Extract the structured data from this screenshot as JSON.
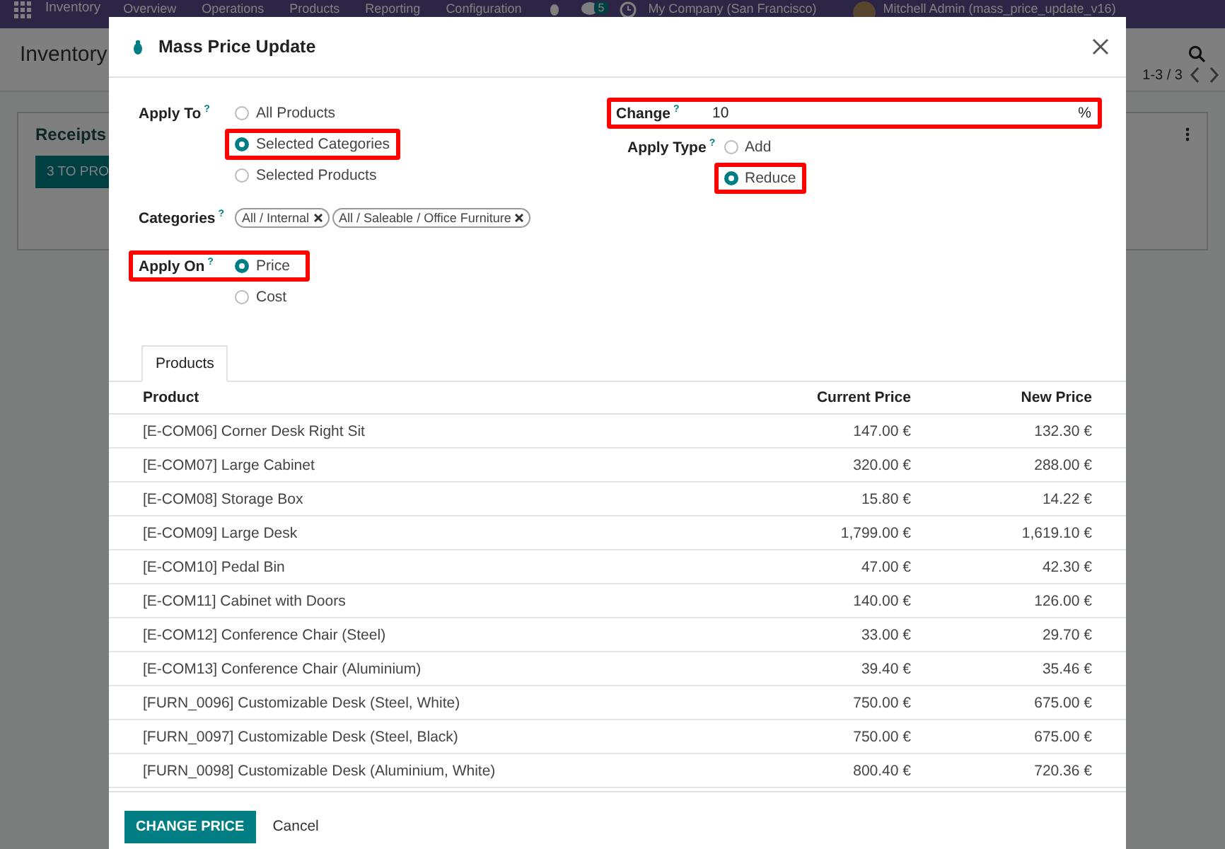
{
  "navbar": {
    "app": "Inventory",
    "menus": [
      "Overview",
      "Operations",
      "Products",
      "Reporting",
      "Configuration"
    ],
    "chat_count": "5",
    "company": "My Company (San Francisco)",
    "user": "Mitchell Admin (mass_price_update_v16)"
  },
  "background": {
    "breadcrumb": "Inventory",
    "pager": "1-3 / 3",
    "card_title": "Receipts",
    "card_button": "3 TO PRO"
  },
  "dialog": {
    "title": "Mass Price Update",
    "apply_to": {
      "label": "Apply To",
      "help": "?",
      "options": [
        {
          "label": "All Products",
          "selected": false,
          "highlighted": false
        },
        {
          "label": "Selected Categories",
          "selected": true,
          "highlighted": true
        },
        {
          "label": "Selected Products",
          "selected": false,
          "highlighted": false
        }
      ]
    },
    "categories": {
      "label": "Categories",
      "help": "?",
      "tags": [
        "All / Internal",
        "All / Saleable / Office Furniture"
      ]
    },
    "apply_on": {
      "label": "Apply On",
      "help": "?",
      "highlighted": true,
      "options": [
        {
          "label": "Price",
          "selected": true,
          "highlighted": false
        },
        {
          "label": "Cost",
          "selected": false,
          "highlighted": false
        }
      ]
    },
    "change": {
      "label": "Change",
      "help": "?",
      "value": "10",
      "unit": "%",
      "highlighted": true
    },
    "apply_type": {
      "label": "Apply Type",
      "help": "?",
      "options": [
        {
          "label": "Add",
          "selected": false,
          "highlighted": false
        },
        {
          "label": "Reduce",
          "selected": true,
          "highlighted": true
        }
      ]
    },
    "tabs": [
      {
        "label": "Products",
        "selected": true
      }
    ],
    "table": {
      "columns": [
        "Product",
        "Current Price",
        "New Price"
      ],
      "rows": [
        [
          "[E-COM06] Corner Desk Right Sit",
          "147.00 €",
          "132.30 €"
        ],
        [
          "[E-COM07] Large Cabinet",
          "320.00 €",
          "288.00 €"
        ],
        [
          "[E-COM08] Storage Box",
          "15.80 €",
          "14.22 €"
        ],
        [
          "[E-COM09] Large Desk",
          "1,799.00 €",
          "1,619.10 €"
        ],
        [
          "[E-COM10] Pedal Bin",
          "47.00 €",
          "42.30 €"
        ],
        [
          "[E-COM11] Cabinet with Doors",
          "140.00 €",
          "126.00 €"
        ],
        [
          "[E-COM12] Conference Chair (Steel)",
          "33.00 €",
          "29.70 €"
        ],
        [
          "[E-COM13] Conference Chair (Aluminium)",
          "39.40 €",
          "35.46 €"
        ],
        [
          "[FURN_0096] Customizable Desk (Steel, White)",
          "750.00 €",
          "675.00 €"
        ],
        [
          "[FURN_0097] Customizable Desk (Steel, Black)",
          "750.00 €",
          "675.00 €"
        ],
        [
          "[FURN_0098] Customizable Desk (Aluminium, White)",
          "800.40 €",
          "720.36 €"
        ]
      ]
    },
    "buttons": [
      {
        "label": "CHANGE PRICE",
        "kind": "primary"
      },
      {
        "label": "Cancel",
        "kind": "link"
      }
    ]
  }
}
